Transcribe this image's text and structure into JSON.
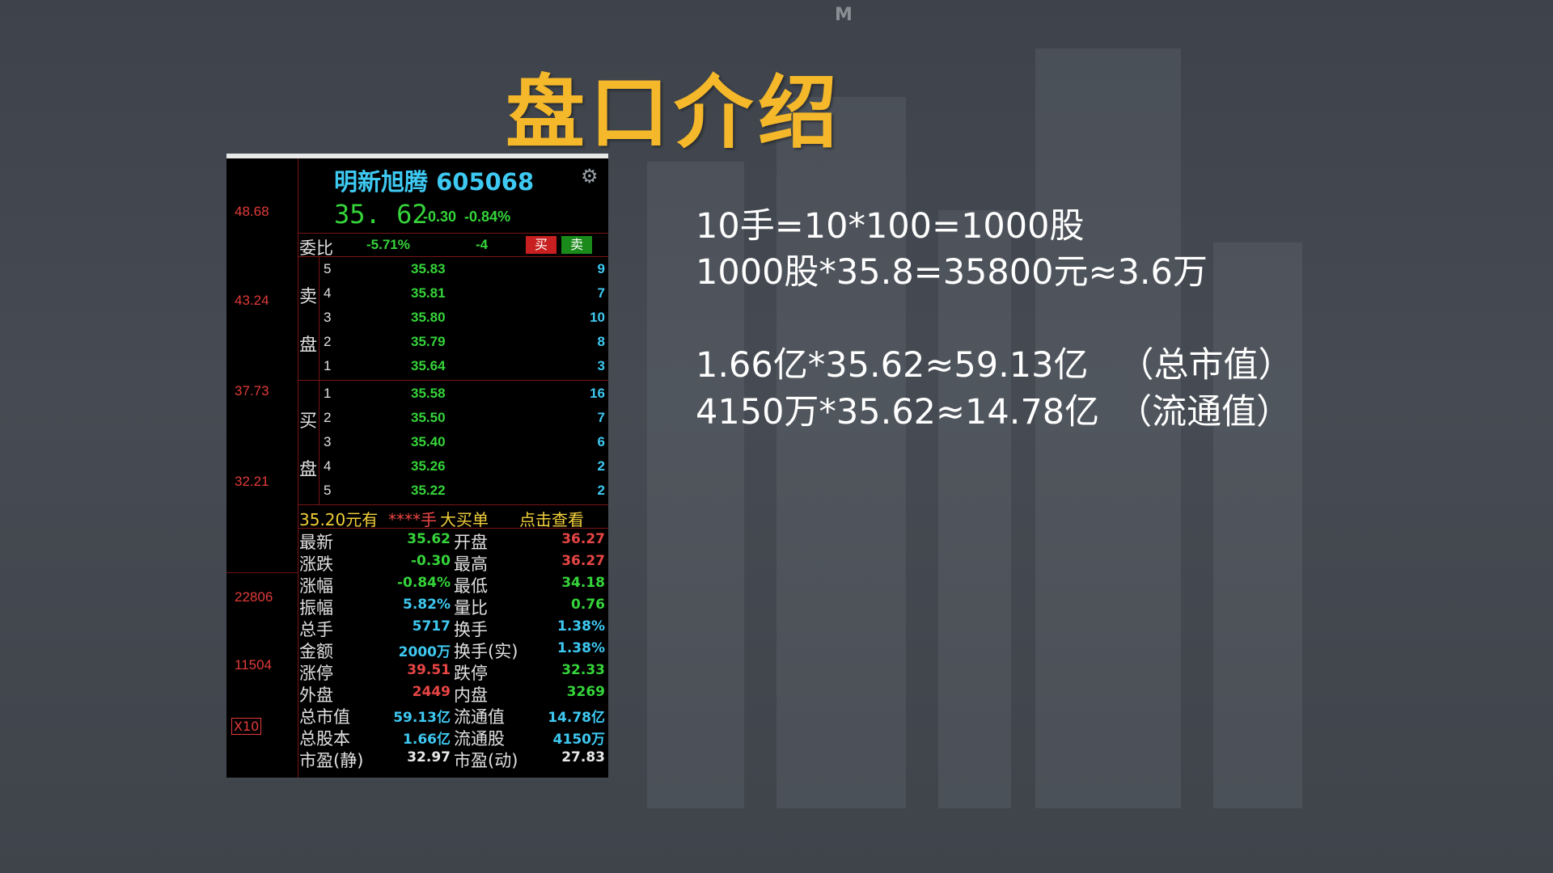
{
  "watermark": "M",
  "title": "盘口介绍",
  "notes": {
    "line1": "10手=10*100=1000股",
    "line2": "1000股*35.8=35800元≈3.6万",
    "line3_calc": "1.66亿*35.62≈59.13亿",
    "line3_tag": "（总市值）",
    "line4_calc": "4150万*35.62≈14.78亿",
    "line4_tag": "（流通值）"
  },
  "axis": {
    "prices": [
      "48.68",
      "43.24",
      "37.73",
      "32.21"
    ],
    "volumes": [
      "22806",
      "11504"
    ],
    "scale": "X10"
  },
  "quote": {
    "name": "明新旭腾 605068",
    "price": "35. 62",
    "change": "-0.30",
    "change_pct": "-0.84%",
    "weibi_label": "委比",
    "weibi_pct": "-5.71%",
    "weicha": "-4",
    "buy_label": "买",
    "sell_label": "卖",
    "sell_side_labels": [
      "卖",
      "盘"
    ],
    "buy_side_labels": [
      "买",
      "盘"
    ],
    "asks": [
      {
        "level": "5",
        "price": "35.83",
        "volume": "9"
      },
      {
        "level": "4",
        "price": "35.81",
        "volume": "7"
      },
      {
        "level": "3",
        "price": "35.80",
        "volume": "10"
      },
      {
        "level": "2",
        "price": "35.79",
        "volume": "8"
      },
      {
        "level": "1",
        "price": "35.64",
        "volume": "3"
      }
    ],
    "bids": [
      {
        "level": "1",
        "price": "35.58",
        "volume": "16"
      },
      {
        "level": "2",
        "price": "35.50",
        "volume": "7"
      },
      {
        "level": "3",
        "price": "35.40",
        "volume": "6"
      },
      {
        "level": "4",
        "price": "35.26",
        "volume": "2"
      },
      {
        "level": "5",
        "price": "35.22",
        "volume": "2"
      }
    ],
    "ad_price": "35.20元有",
    "ad_hands": "****手",
    "ad_big": "大买单",
    "ad_link": "点击查看",
    "stats": [
      {
        "l1": "最新",
        "v1": "35.62",
        "c1": "green",
        "l2": "开盘",
        "v2": "36.27",
        "c2": "red"
      },
      {
        "l1": "涨跌",
        "v1": "-0.30",
        "c1": "green",
        "l2": "最高",
        "v2": "36.27",
        "c2": "red"
      },
      {
        "l1": "涨幅",
        "v1": "-0.84%",
        "c1": "green",
        "l2": "最低",
        "v2": "34.18",
        "c2": "green"
      },
      {
        "l1": "振幅",
        "v1": "5.82%",
        "c1": "cyan",
        "l2": "量比",
        "v2": "0.76",
        "c2": "green"
      },
      {
        "l1": "总手",
        "v1": "5717",
        "c1": "cyan",
        "l2": "换手",
        "v2": "1.38%",
        "c2": "cyan"
      },
      {
        "l1": "金额",
        "v1": "2000万",
        "c1": "cyan",
        "l2": "换手(实)",
        "v2": "1.38%",
        "c2": "cyan"
      },
      {
        "l1": "涨停",
        "v1": "39.51",
        "c1": "red",
        "l2": "跌停",
        "v2": "32.33",
        "c2": "green"
      },
      {
        "l1": "外盘",
        "v1": "2449",
        "c1": "red",
        "l2": "内盘",
        "v2": "3269",
        "c2": "green"
      },
      {
        "l1": "总市值",
        "v1": "59.13亿",
        "c1": "cyan",
        "l2": "流通值",
        "v2": "14.78亿",
        "c2": "cyan"
      },
      {
        "l1": "总股本",
        "v1": "1.66亿",
        "c1": "cyan",
        "l2": "流通股",
        "v2": "4150万",
        "c2": "cyan"
      },
      {
        "l1": "市盈(静)",
        "v1": "32.97",
        "c1": "white",
        "l2": "市盈(动)",
        "v2": "27.83",
        "c2": "white"
      }
    ]
  }
}
